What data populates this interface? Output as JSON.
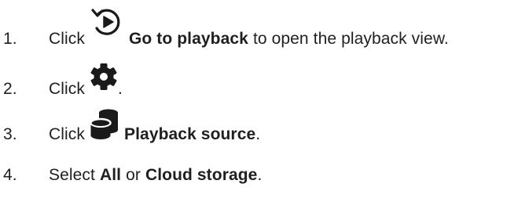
{
  "steps": [
    {
      "number": "1.",
      "verb": "Click",
      "icon": "playback-icon",
      "bold": "Go to playback",
      "after": "to open the playback view."
    },
    {
      "number": "2.",
      "verb": "Click",
      "icon": "gear-icon",
      "after": "."
    },
    {
      "number": "3.",
      "verb": "Click",
      "icon": "database-icon",
      "bold": "Playback source",
      "after": "."
    },
    {
      "number": "4.",
      "verb": "Select",
      "bold_a": "All",
      "middle": "or",
      "bold_b": "Cloud storage",
      "after": "."
    }
  ],
  "colors": {
    "text": "#1f1f1f",
    "icon": "#1a1a1a"
  }
}
